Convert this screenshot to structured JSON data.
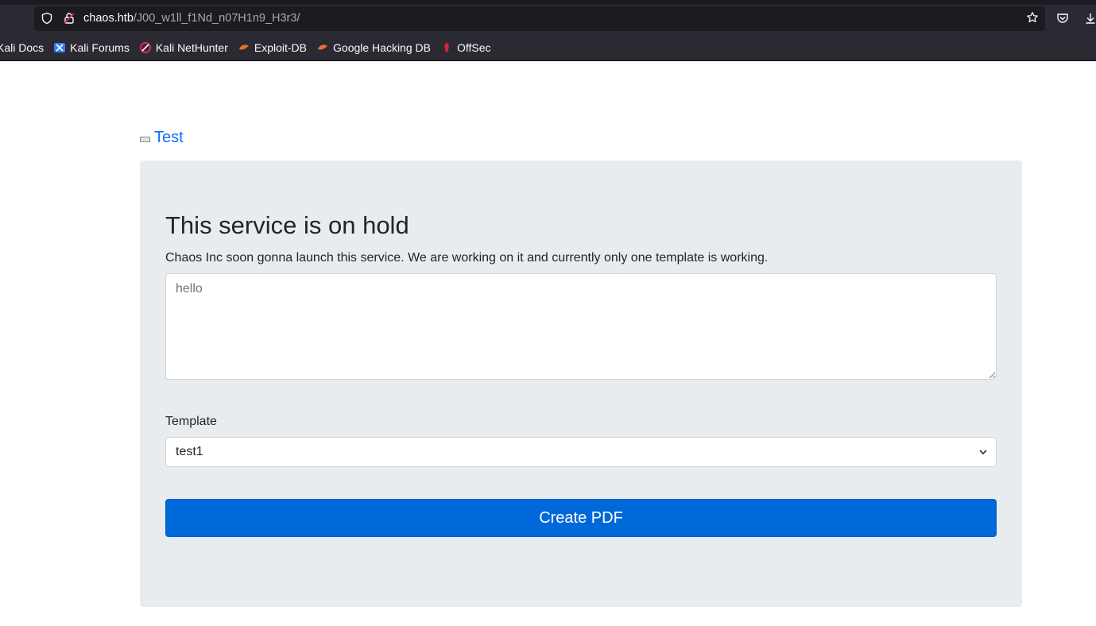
{
  "browser": {
    "url_host": "chaos.htb",
    "url_path": "/J00_w1ll_f1Nd_n07H1n9_H3r3/",
    "bookmarks": [
      {
        "label": "Kali Docs",
        "icon": "kali-dragon-icon"
      },
      {
        "label": "Kali Forums",
        "icon": "kali-forums-icon"
      },
      {
        "label": "Kali NetHunter",
        "icon": "nethunter-icon"
      },
      {
        "label": "Exploit-DB",
        "icon": "exploit-db-icon"
      },
      {
        "label": "Google Hacking DB",
        "icon": "ghdb-icon"
      },
      {
        "label": "OffSec",
        "icon": "offsec-icon"
      }
    ]
  },
  "page": {
    "link_text": "Test",
    "heading": "This service is on hold",
    "lead": "Chaos Inc soon gonna launch this service. We are working on it and currently only one template is working.",
    "textarea_placeholder": "hello",
    "template_label": "Template",
    "template_selected": "test1",
    "button_label": "Create PDF"
  },
  "colors": {
    "link": "#0d6efd",
    "button": "#0069d9",
    "card": "#e9ecef",
    "chrome": "#2b2a33"
  }
}
